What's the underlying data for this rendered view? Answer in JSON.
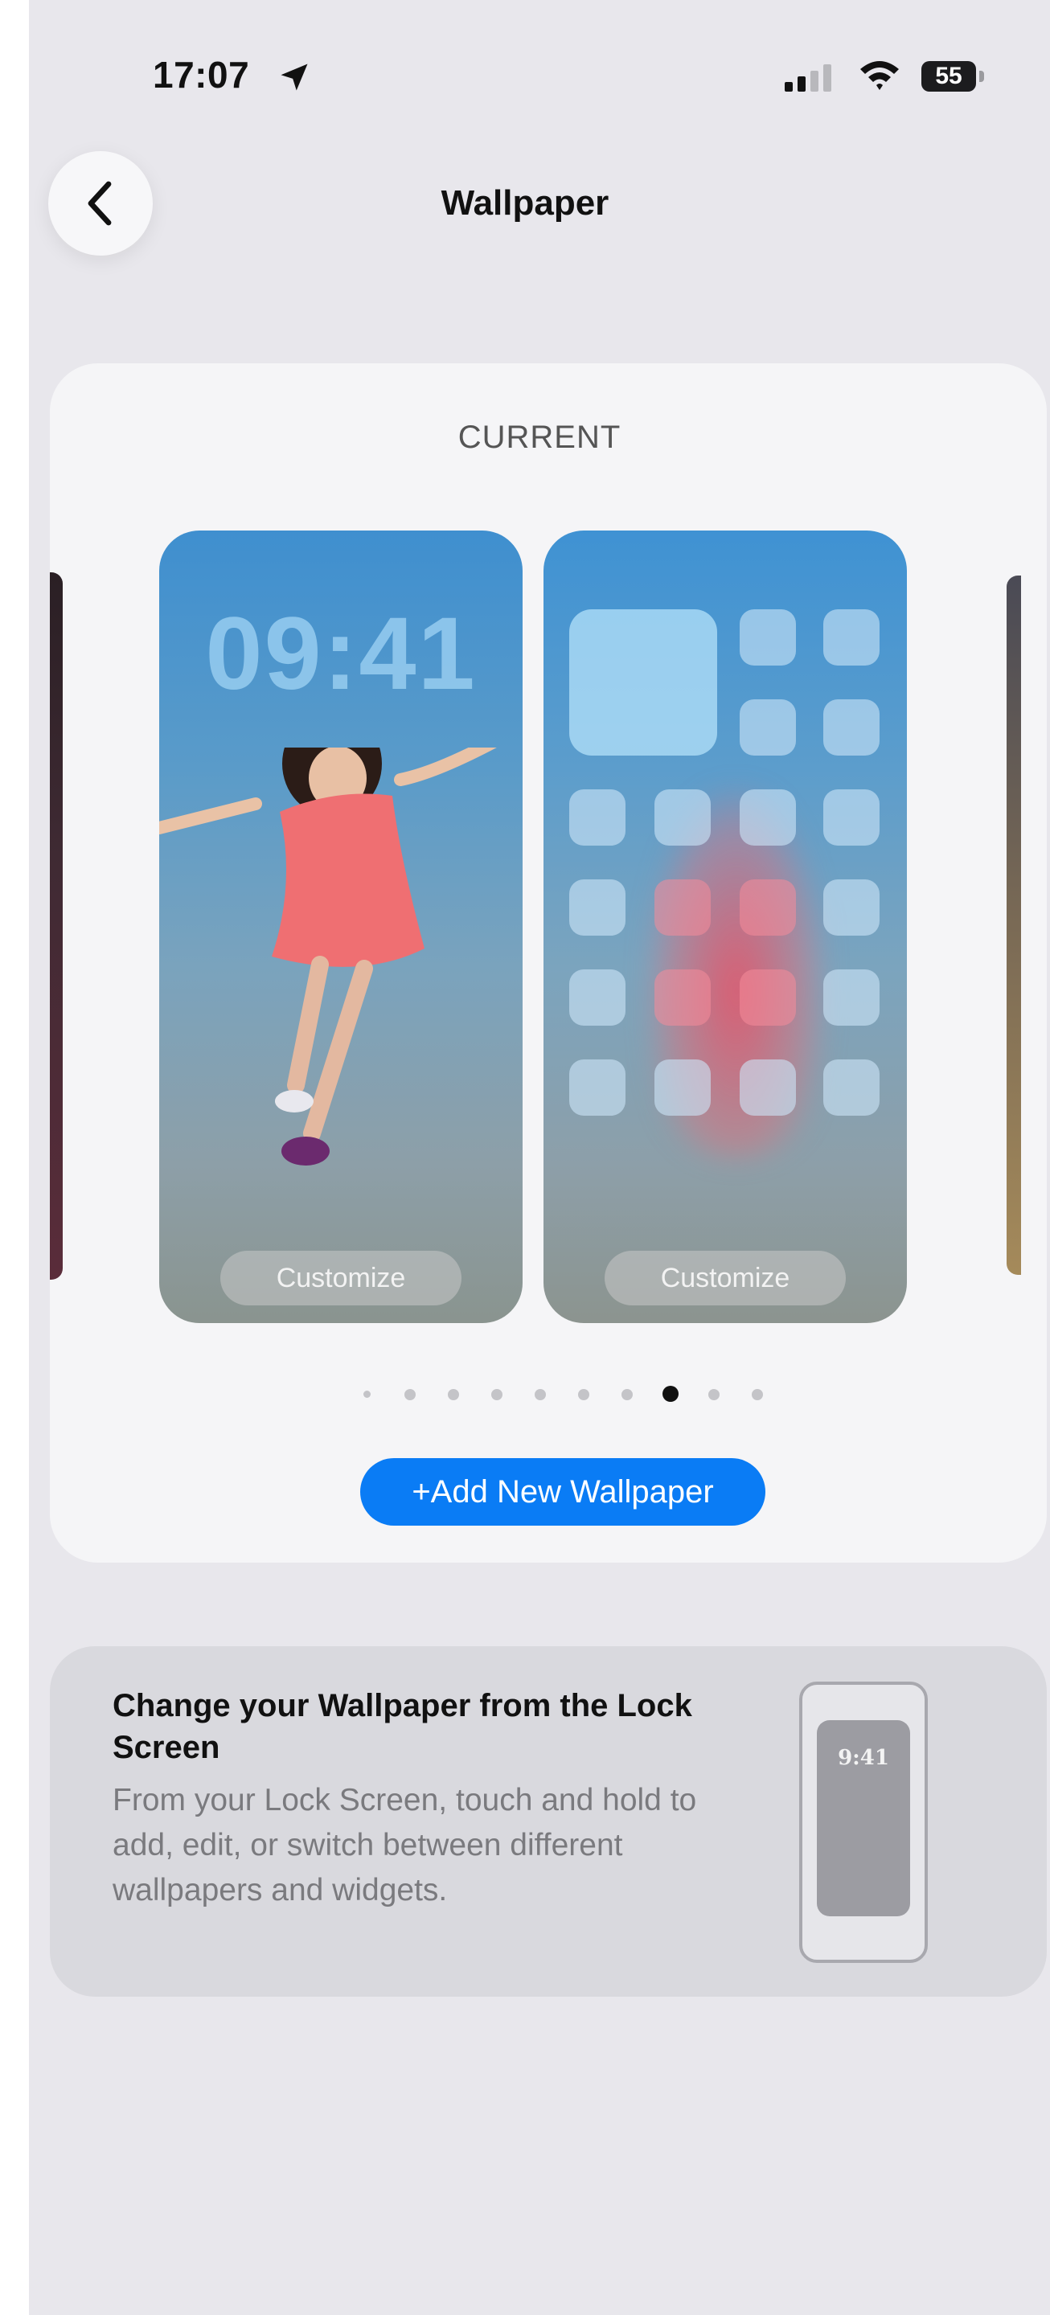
{
  "status_bar": {
    "time": "17:07",
    "battery": "55"
  },
  "nav": {
    "title": "Wallpaper"
  },
  "current_section": {
    "label": "CURRENT",
    "lock_screen_clock": "09:41",
    "lock_customize_label": "Customize",
    "home_customize_label": "Customize",
    "page_count": 10,
    "active_page_index": 7,
    "add_button_label": "+Add New Wallpaper"
  },
  "info_card": {
    "title": "Change your Wallpaper from the Lock Screen",
    "body": "From your Lock Screen, touch and hold to add, edit, or switch between different wallpapers and widgets.",
    "preview_clock": "9:41"
  },
  "icons": {
    "back": "chevron-left-icon",
    "location": "location-arrow-icon",
    "signal": "cellular-signal-icon",
    "wifi": "wifi-icon",
    "battery": "battery-icon"
  },
  "colors": {
    "accent": "#0a7cf5",
    "background": "#e8e7ec",
    "card": "#f5f5f7",
    "info_card": "#d9d9de"
  }
}
